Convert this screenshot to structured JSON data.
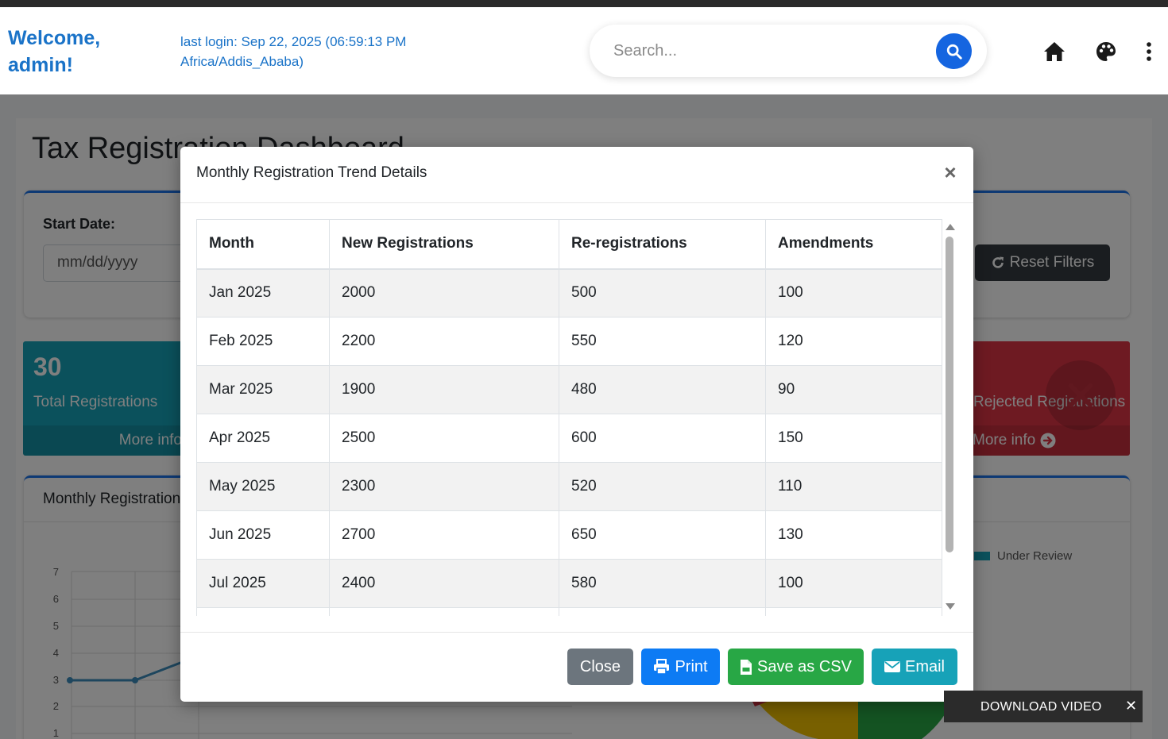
{
  "header": {
    "welcome_line1": "Welcome,",
    "welcome_line2": "admin!",
    "last_login_line1": "last login: Sep 22, 2025 (06:59:13 PM",
    "last_login_line2": "Africa/Addis_Ababa)",
    "search_placeholder": "Search..."
  },
  "dashboard": {
    "title": "Tax Registration Dashboard",
    "start_date_label": "Start Date:",
    "date_placeholder": "mm/dd/yyyy",
    "reset_label": "Reset Filters",
    "total_count": "30",
    "total_label": "Total Registrations",
    "more_info": "More info",
    "rejected_label": "Rejected Registrations",
    "more_info_right": "More info",
    "chart_title": "Monthly Registration Trend",
    "legend_under_review": "Under Review",
    "y_ticks": [
      "7",
      "6",
      "5",
      "4",
      "3",
      "2",
      "1"
    ]
  },
  "modal": {
    "title": "Monthly Registration Trend Details",
    "columns": [
      "Month",
      "New Registrations",
      "Re-registrations",
      "Amendments"
    ],
    "rows": [
      [
        "Jan 2025",
        "2000",
        "500",
        "100"
      ],
      [
        "Feb 2025",
        "2200",
        "550",
        "120"
      ],
      [
        "Mar 2025",
        "1900",
        "480",
        "90"
      ],
      [
        "Apr 2025",
        "2500",
        "600",
        "150"
      ],
      [
        "May 2025",
        "2300",
        "520",
        "110"
      ],
      [
        "Jun 2025",
        "2700",
        "650",
        "130"
      ],
      [
        "Jul 2025",
        "2400",
        "580",
        "100"
      ]
    ],
    "buttons": {
      "close": "Close",
      "print": "Print",
      "csv": "Save as CSV",
      "email": "Email"
    }
  },
  "download_video": "DOWNLOAD VIDEO",
  "colors": {
    "brand_blue": "#1a73c8",
    "search_button": "#1565e0",
    "close_button": "#6c757d",
    "print_button": "#0d7bf4",
    "csv_button": "#28a745",
    "email_button": "#17a2b8"
  }
}
